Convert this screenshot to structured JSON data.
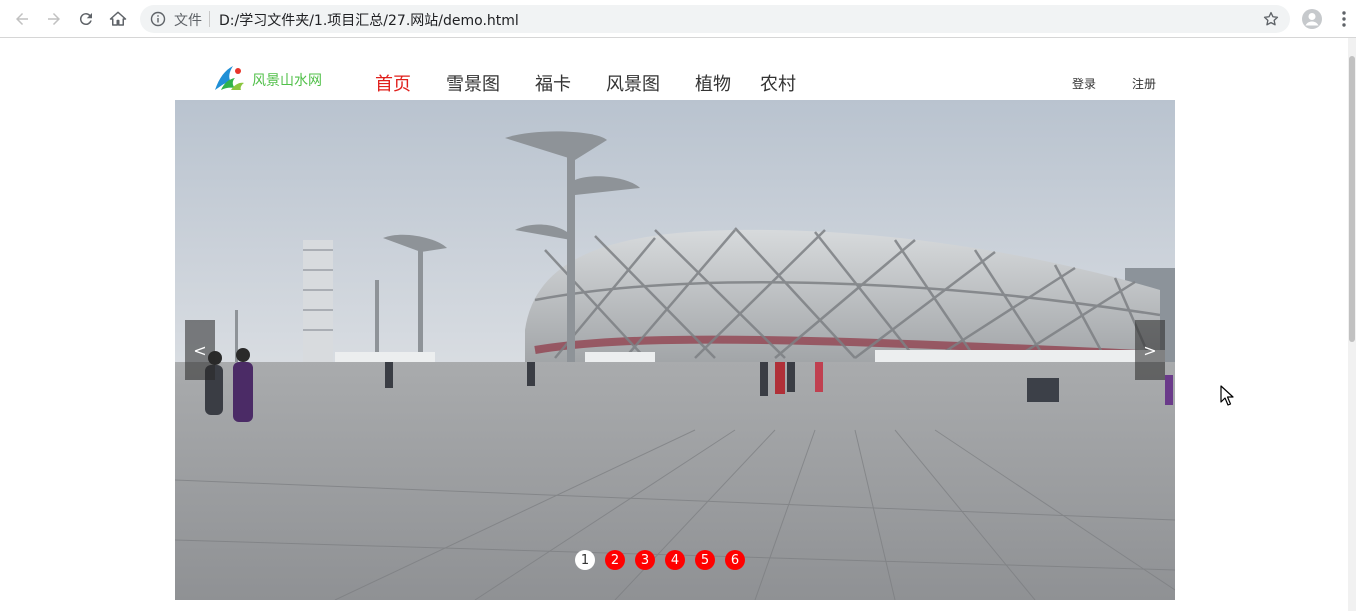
{
  "browser": {
    "file_label": "文件",
    "url": "D:/学习文件夹/1.项目汇总/27.网站/demo.html"
  },
  "site": {
    "logo_text": "风景山水网",
    "menu": [
      {
        "label": "首页",
        "active": true
      },
      {
        "label": "雪景图",
        "active": false
      },
      {
        "label": "福卡",
        "active": false
      },
      {
        "label": "风景图",
        "active": false
      },
      {
        "label": "植物",
        "active": false
      },
      {
        "label": "农村",
        "active": false
      }
    ],
    "login": "登录",
    "register": "注册"
  },
  "carousel": {
    "prev_label": "<",
    "next_label": ">",
    "dots": [
      "1",
      "2",
      "3",
      "4",
      "5",
      "6"
    ],
    "active_index": 0
  }
}
